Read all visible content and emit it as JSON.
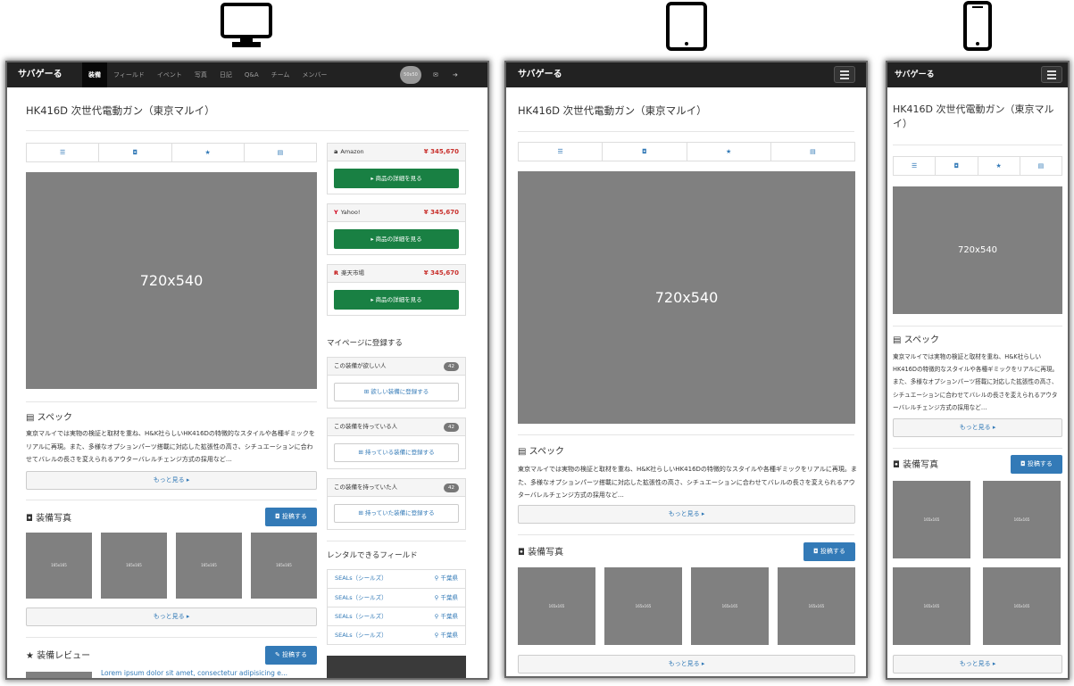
{
  "device_icons": [
    "desktop-icon",
    "tablet-icon",
    "phone-icon"
  ],
  "site": {
    "brand": "サバゲーる"
  },
  "nav": {
    "items": [
      "装備",
      "フィールド",
      "イベント",
      "写真",
      "日記",
      "Q&A",
      "チーム",
      "メンバー"
    ],
    "active_index": 0,
    "avatar_text": "50x50",
    "mail_icon": "envelope-icon",
    "logout_icon": "sign-out-icon"
  },
  "product": {
    "title": "HK416D 次世代電動ガン（東京マルイ）",
    "main_image_label": "720x540",
    "tabs": [
      "list-icon",
      "camera-icon",
      "star-icon",
      "film-icon"
    ]
  },
  "spec": {
    "heading": "スペック",
    "desktop_text": "東京マルイでは実物の検証と取材を重ね、H&K社らしいHK416Dの特徴的なスタイルや各種ギミックをリアルに再現。また、多様なオプションパーツ搭載に対応した拡張性の高さ、シチュエーションに合わせてバレルの長さを変えられるアウターバレルチェンジ方式の採用など…",
    "tablet_text": "東京マルイでは実物の検証と取材を重ね、H&K社らしいHK416Dの特徴的なスタイルや各種ギミックをリアルに再現。また、多様なオプションパーツ搭載に対応した拡張性の高さ、シチュエーションに合わせてバレルの長さを変えられるアウターバレルチェンジ方式の採用など…",
    "phone_text": "東京マルイでは実物の検証と取材を重ね、H&K社らしいHK416Dの特徴的なスタイルや各種ギミックをリアルに再現。また、多様なオプションパーツ搭載に対応した拡張性の高さ、シチュエーションに合わせてバレルの長さを変えられるアウターバレルチェンジ方式の採用など…",
    "more": "もっと見る ▸"
  },
  "photos": {
    "heading": "装備写真",
    "post_button": "投稿する",
    "thumb_label": "165x165",
    "more": "もっと見る ▸"
  },
  "review": {
    "heading": "装備レビュー",
    "post_button": "投稿する",
    "first_title": "Lorem ipsum dolor sit amet, consectetur adipisicing e..."
  },
  "shops": [
    {
      "name": "Amazon",
      "logo": "a",
      "price": "¥ 345,670",
      "button": "商品の詳細を見る"
    },
    {
      "name": "Yahoo!",
      "logo": "Y",
      "price": "¥ 345,670",
      "button": "商品の詳細を見る"
    },
    {
      "name": "楽天市場",
      "logo": "R",
      "price": "¥ 345,670",
      "button": "商品の詳細を見る"
    }
  ],
  "mypage": {
    "heading": "マイページに登録する",
    "panels": [
      {
        "label": "この装備が欲しい人",
        "count": "42",
        "button": "欲しい装備に登録する"
      },
      {
        "label": "この装備を持っている人",
        "count": "42",
        "button": "持っている装備に登録する"
      },
      {
        "label": "この装備を持っていた人",
        "count": "42",
        "button": "持っていた装備に登録する"
      }
    ]
  },
  "rental": {
    "heading": "レンタルできるフィールド",
    "rows": [
      {
        "field": "SEALs（シールズ）",
        "pref": "千葉県"
      },
      {
        "field": "SEALs（シールズ）",
        "pref": "千葉県"
      },
      {
        "field": "SEALs（シールズ）",
        "pref": "千葉県"
      },
      {
        "field": "SEALs（シールズ）",
        "pref": "千葉県"
      }
    ]
  }
}
